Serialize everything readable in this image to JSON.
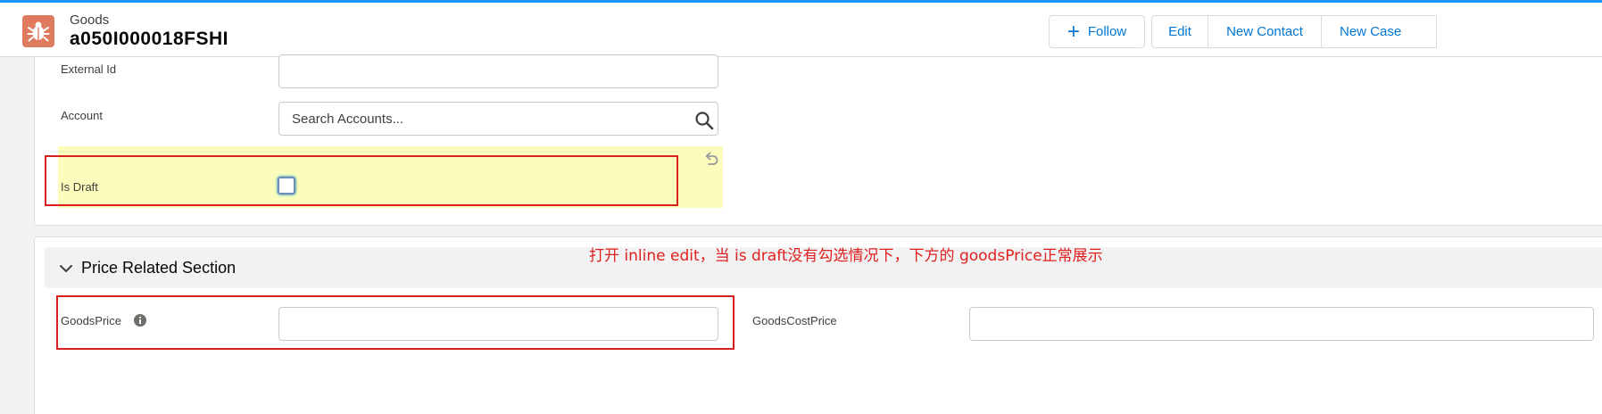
{
  "header": {
    "object_label": "Goods",
    "record_name": "a050I000018FSHI",
    "icon": "bug-icon",
    "icon_color": "#e07a5f"
  },
  "actions": {
    "follow_label": "Follow",
    "edit_label": "Edit",
    "new_contact_label": "New Contact",
    "new_case_label": "New Case"
  },
  "fields": {
    "external_id": {
      "label": "External Id",
      "value": ""
    },
    "account": {
      "label": "Account",
      "placeholder": "Search Accounts..."
    },
    "is_draft": {
      "label": "Is Draft",
      "checked": false
    }
  },
  "price_section": {
    "title": "Price Related Section",
    "goods_price": {
      "label": "GoodsPrice",
      "value": ""
    },
    "goods_cost_price": {
      "label": "GoodsCostPrice",
      "value": ""
    }
  },
  "annotation": {
    "text": "打开 inline edit，当 is draft没有勾选情况下，下方的 goodsPrice正常展示",
    "color": "#e02020"
  },
  "colors": {
    "brand": "#0176d3",
    "edited_highlight": "#fcfdbc"
  }
}
